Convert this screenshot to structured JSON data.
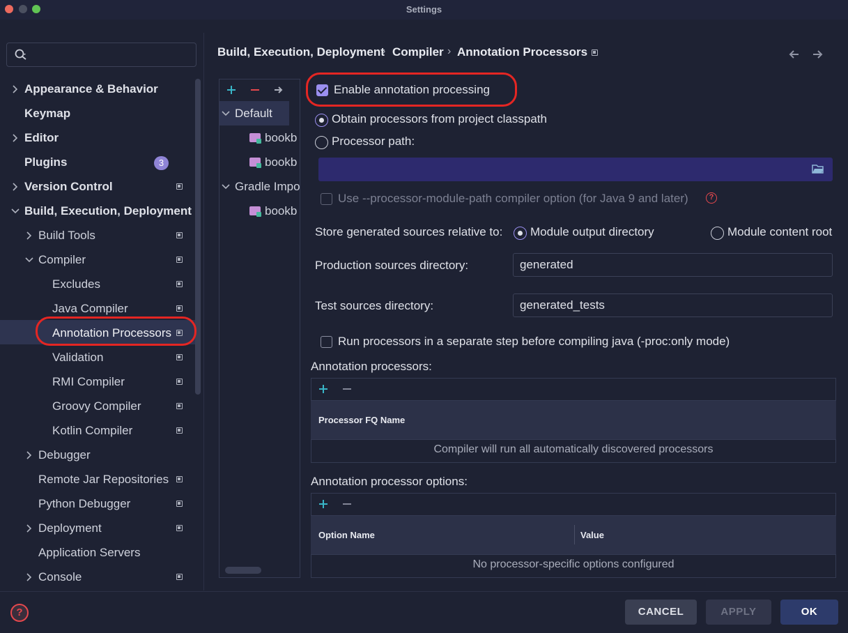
{
  "window": {
    "title": "Settings"
  },
  "search": {
    "placeholder": ""
  },
  "sidebar": {
    "appearance": "Appearance & Behavior",
    "keymap": "Keymap",
    "editor": "Editor",
    "plugins": "Plugins",
    "plugins_badge": "3",
    "version_control": "Version Control",
    "build": "Build, Execution, Deployment",
    "build_tools": "Build Tools",
    "compiler": "Compiler",
    "excludes": "Excludes",
    "java_compiler": "Java Compiler",
    "annotation_processors": "Annotation Processors",
    "validation": "Validation",
    "rmi_compiler": "RMI Compiler",
    "groovy_compiler": "Groovy Compiler",
    "kotlin_compiler": "Kotlin Compiler",
    "debugger": "Debugger",
    "remote_jar": "Remote Jar Repositories",
    "python_debugger": "Python Debugger",
    "deployment": "Deployment",
    "app_servers": "Application Servers",
    "console": "Console"
  },
  "breadcrumb": {
    "part1": "Build, Execution, Deployment",
    "part2": "Compiler",
    "part3": "Annotation Processors",
    "sep": "›"
  },
  "module_tree": {
    "default": "Default",
    "module1": "bookb",
    "module2": "bookb",
    "gradle": "Gradle Impo",
    "module3": "bookb"
  },
  "settings": {
    "enable_annotation": "Enable annotation processing",
    "obtain_classpath": "Obtain processors from project classpath",
    "processor_path": "Processor path:",
    "processor_path_value": "",
    "use_module_path": "Use --processor-module-path compiler option (for Java 9 and later)",
    "store_relative": "Store generated sources relative to:",
    "module_output": "Module output directory",
    "module_content": "Module content root",
    "production_label": "Production sources directory:",
    "production_value": "generated",
    "test_label": "Test sources directory:",
    "test_value": "generated_tests",
    "separate_step": "Run processors in a separate step before compiling java (-proc:only mode)"
  },
  "processors_table": {
    "title": "Annotation processors:",
    "column": "Processor FQ Name",
    "empty": "Compiler will run all automatically discovered processors"
  },
  "options_table": {
    "title": "Annotation processor options:",
    "col_name": "Option Name",
    "col_value": "Value",
    "empty": "No processor-specific options configured"
  },
  "buttons": {
    "cancel": "CANCEL",
    "apply": "APPLY",
    "ok": "OK",
    "help": "?"
  },
  "colors": {
    "accent": "#9b8ff0",
    "highlight": "#e42623",
    "background": "#1e2233"
  }
}
